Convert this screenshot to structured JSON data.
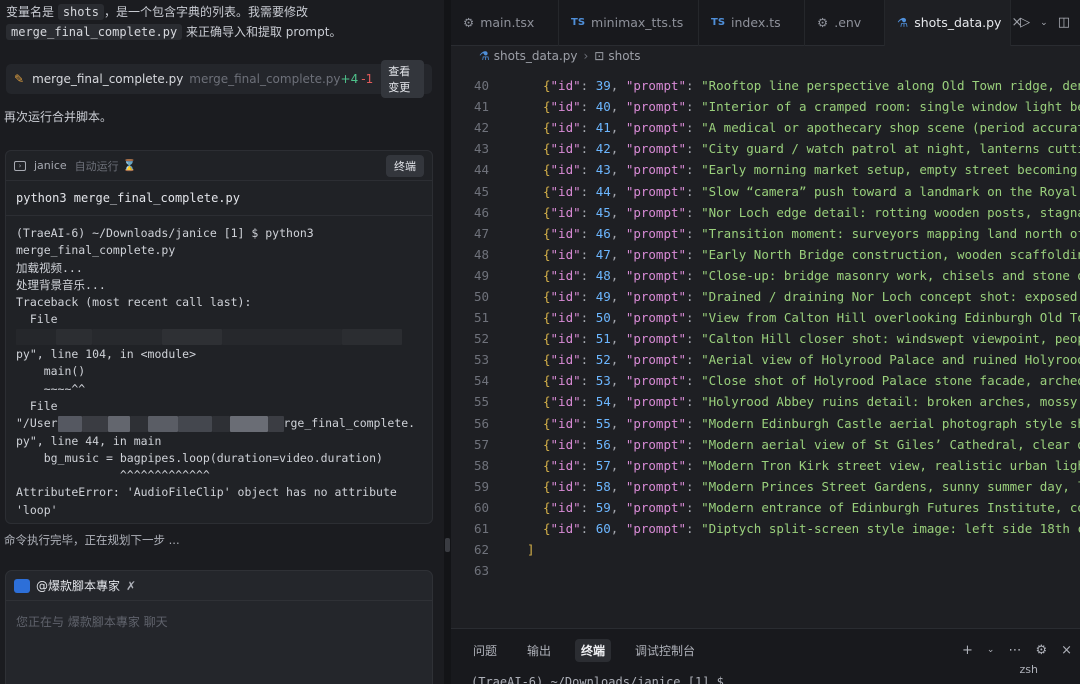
{
  "chat": {
    "intro_before": "变量名是 ",
    "intro_var": "shots",
    "intro_mid": "，是一个包含字典的列表。我需要修改",
    "intro_file": "merge_final_complete.py",
    "intro_after": " 来正确导入和提取 prompt。",
    "file_card": {
      "name": "merge_final_complete.py",
      "path": "merge_final_complete.py",
      "added": "+4",
      "removed": "-1",
      "review_label": "查看变更"
    },
    "rerun_text": "再次运行合并脚本。",
    "terminal_card": {
      "name": "janice",
      "auto_label": "自动运行",
      "terminal_button": "终端",
      "command": "python3 merge_final_complete.py",
      "output": {
        "l1": "(TraeAI-6) ~/Downloads/janice [1] $ python3",
        "l2": "merge_final_complete.py",
        "l3": "加载视频...",
        "l4": "处理背景音乐...",
        "l5": "Traceback (most recent call last):",
        "l6": "  File",
        "l8": "py\", line 104, in <module>",
        "l9": "    main()",
        "l10": "    ~~~~^^",
        "l11": "  File",
        "l12a": "\"/User",
        "l12b": "rge_final_complete.",
        "l13": "py\", line 44, in main",
        "l14": "    bg_music = bagpipes.loop(duration=video.duration)",
        "l15": "               ^^^^^^^^^^^^^",
        "l16": "AttributeError: 'AudioFileClip' object has no attribute",
        "l17": "'loop'"
      }
    },
    "status_text": "命令执行完毕，正在规划下一步 ...",
    "composer": {
      "agent_name": "@爆款腳本專家",
      "placeholder": "您正在与 爆款腳本專家 聊天"
    }
  },
  "editor": {
    "tabs": [
      {
        "label": "main.tsx",
        "icon": "gear-icon"
      },
      {
        "label": "minimax_tts.ts",
        "icon": "ts-icon"
      },
      {
        "label": "index.ts",
        "icon": "ts-icon"
      },
      {
        "label": ".env",
        "icon": "gear-icon"
      },
      {
        "label": "shots_data.py",
        "icon": "python-icon"
      }
    ],
    "breadcrumb": [
      "shots_data.py",
      "shots"
    ],
    "code_lines": [
      {
        "num": "40",
        "id": "39",
        "prompt": "\"Rooftop line perspective along Old Town ridge, den"
      },
      {
        "num": "41",
        "id": "40",
        "prompt": "\"Interior of a cramped room: single window light be"
      },
      {
        "num": "42",
        "id": "41",
        "prompt": "\"A medical or apothecary shop scene (period accurat"
      },
      {
        "num": "43",
        "id": "42",
        "prompt": "\"City guard / watch patrol at night, lanterns cutti"
      },
      {
        "num": "44",
        "id": "43",
        "prompt": "\"Early morning market setup, empty street becoming"
      },
      {
        "num": "45",
        "id": "44",
        "prompt": "\"Slow “camera” push toward a landmark on the Royal"
      },
      {
        "num": "46",
        "id": "45",
        "prompt": "\"Nor Loch edge detail: rotting wooden posts, stagna"
      },
      {
        "num": "47",
        "id": "46",
        "prompt": "\"Transition moment: surveyors mapping land north of"
      },
      {
        "num": "48",
        "id": "47",
        "prompt": "\"Early North Bridge construction, wooden scaffoldin"
      },
      {
        "num": "49",
        "id": "48",
        "prompt": "\"Close-up: bridge masonry work, chisels and stone d"
      },
      {
        "num": "50",
        "id": "49",
        "prompt": "\"Drained / draining Nor Loch concept shot: exposed"
      },
      {
        "num": "51",
        "id": "50",
        "prompt": "\"View from Calton Hill overlooking Edinburgh Old To"
      },
      {
        "num": "52",
        "id": "51",
        "prompt": "\"Calton Hill closer shot: windswept viewpoint, peop"
      },
      {
        "num": "53",
        "id": "52",
        "prompt": "\"Aerial view of Holyrood Palace and ruined Holyrood"
      },
      {
        "num": "54",
        "id": "53",
        "prompt": "\"Close shot of Holyrood Palace stone facade, arched"
      },
      {
        "num": "55",
        "id": "54",
        "prompt": "\"Holyrood Abbey ruins detail: broken arches, mossy"
      },
      {
        "num": "56",
        "id": "55",
        "prompt": "\"Modern Edinburgh Castle aerial photograph style sh"
      },
      {
        "num": "57",
        "id": "56",
        "prompt": "\"Modern aerial view of St Giles’ Cathedral, clear d"
      },
      {
        "num": "58",
        "id": "57",
        "prompt": "\"Modern Tron Kirk street view, realistic urban ligh"
      },
      {
        "num": "59",
        "id": "58",
        "prompt": "\"Modern Princes Street Gardens, sunny summer day, l"
      },
      {
        "num": "60",
        "id": "59",
        "prompt": "\"Modern entrance of Edinburgh Futures Institute, co"
      },
      {
        "num": "61",
        "id": "60",
        "prompt": "\"Diptych split-screen style image: left side 18th c"
      }
    ],
    "line62": {
      "num": "62",
      "text": "]"
    },
    "line63": {
      "num": "63",
      "text": ""
    },
    "key_id": "\"id\"",
    "key_prompt": "\"prompt\"",
    "panel": {
      "tabs": [
        "问题",
        "输出",
        "终端",
        "调试控制台"
      ],
      "active_tab": "终端",
      "shell": "zsh",
      "prompt_line": "(TraeAI-6) ~/Downloads/janice [1] $"
    }
  },
  "colors": {
    "accent": "#4f8fd9",
    "added": "#4ec28b",
    "removed": "#e05a5a",
    "string": "#9ad07c",
    "number": "#6cb6ff",
    "key": "#d98bd6",
    "bracket": "#d6b24a"
  }
}
